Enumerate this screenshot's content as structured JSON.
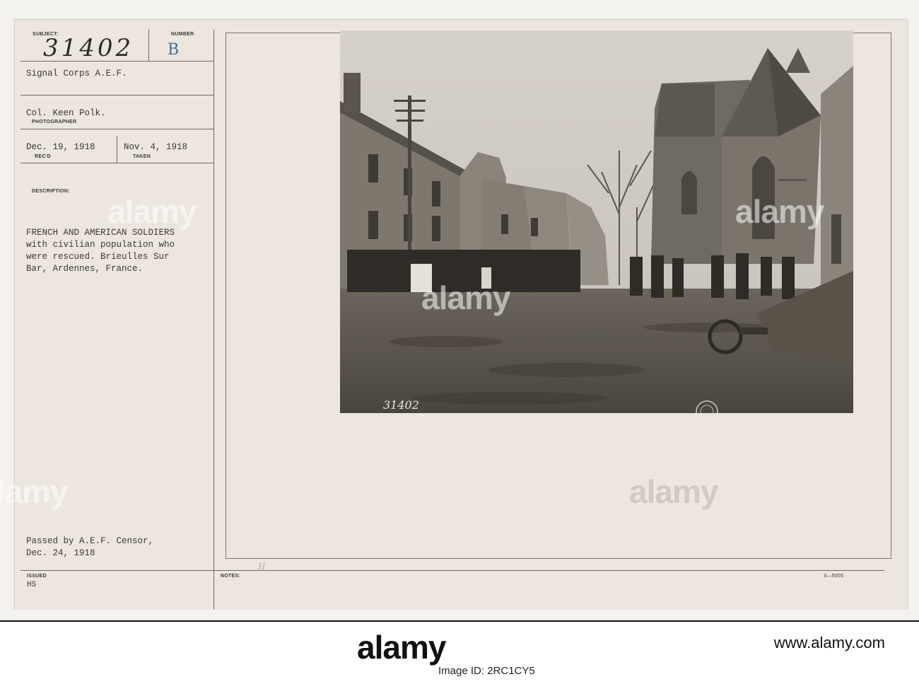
{
  "card": {
    "subject_label": "SUBJECT:",
    "number_label": "NUMBER",
    "subject_number": "31402",
    "number_mark": "B",
    "unit": "Signal Corps A.E.F.",
    "photographer_name": "Col. Keen Polk.",
    "photographer_label": "PHOTOGRAPHER",
    "recd_date": "Dec. 19, 1918",
    "recd_label": "REC'D",
    "taken_date": "Nov. 4, 1918",
    "taken_label": "TAKEN",
    "description_label": "DESCRIPTION:",
    "description_lines": [
      "FRENCH AND AMERICAN SOLDIERS",
      "with civilian population who",
      "were rescued. Brieulles Sur",
      "Bar, Ardennes, France."
    ],
    "censor_lines": [
      "Passed by A.E.F. Censor,",
      "Dec. 24, 1918"
    ],
    "issued_label": "ISSUED",
    "issued_value": "HS",
    "notes_label": "NOTES:",
    "notes_hand": "H",
    "form_code": "3—5005"
  },
  "photo": {
    "caption_number": "31402"
  },
  "watermark": {
    "text": "alamy"
  },
  "footer": {
    "logo": "alamy",
    "image_id": "Image ID: 2RC1CY5",
    "site": "www.alamy.com"
  }
}
